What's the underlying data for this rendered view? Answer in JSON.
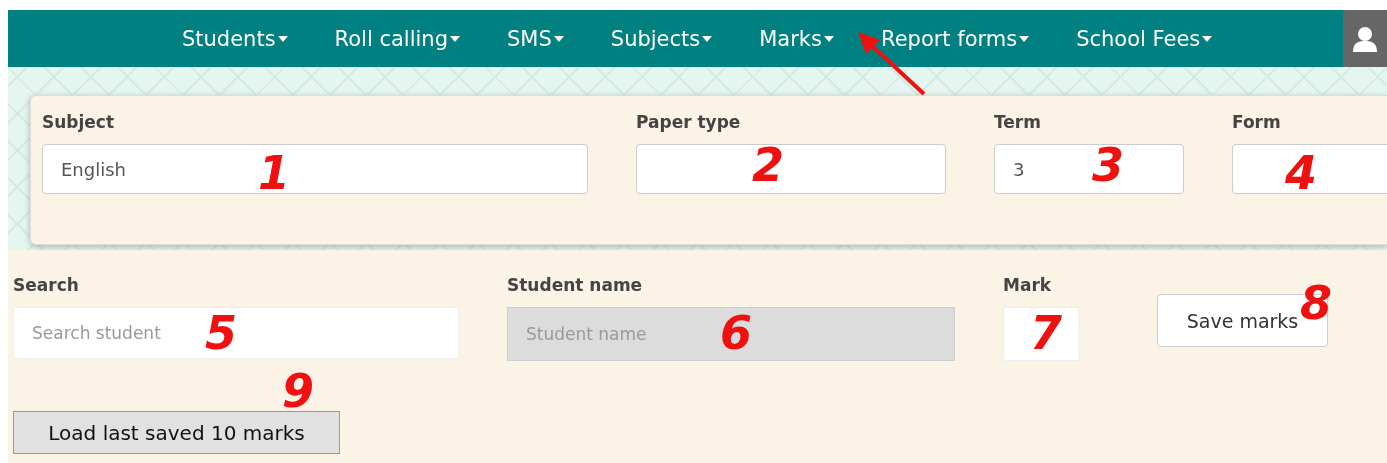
{
  "nav": {
    "items": [
      {
        "label": "Students"
      },
      {
        "label": "Roll calling"
      },
      {
        "label": "SMS"
      },
      {
        "label": "Subjects"
      },
      {
        "label": "Marks"
      },
      {
        "label": "Report forms"
      },
      {
        "label": "School Fees"
      }
    ]
  },
  "filters": [
    {
      "label": "Subject",
      "value": "English"
    },
    {
      "label": "Paper type"
    },
    {
      "label": "Term",
      "value": "3"
    },
    {
      "label": "Form"
    }
  ],
  "entry": {
    "fields": [
      {
        "label": "Search",
        "placeholder": "Search student",
        "disabled": false
      },
      {
        "label": "Student name",
        "placeholder": "Student name",
        "disabled": true
      },
      {
        "label": "Mark",
        "disabled": false
      }
    ],
    "save_button": "Save marks",
    "load_button": "Load last saved 10 marks"
  },
  "annotations": [
    {
      "text": "1"
    },
    {
      "text": "2"
    },
    {
      "text": "3"
    },
    {
      "text": "4"
    },
    {
      "text": "5"
    },
    {
      "text": "6"
    },
    {
      "text": "7"
    },
    {
      "text": "8"
    },
    {
      "text": "9"
    }
  ]
}
